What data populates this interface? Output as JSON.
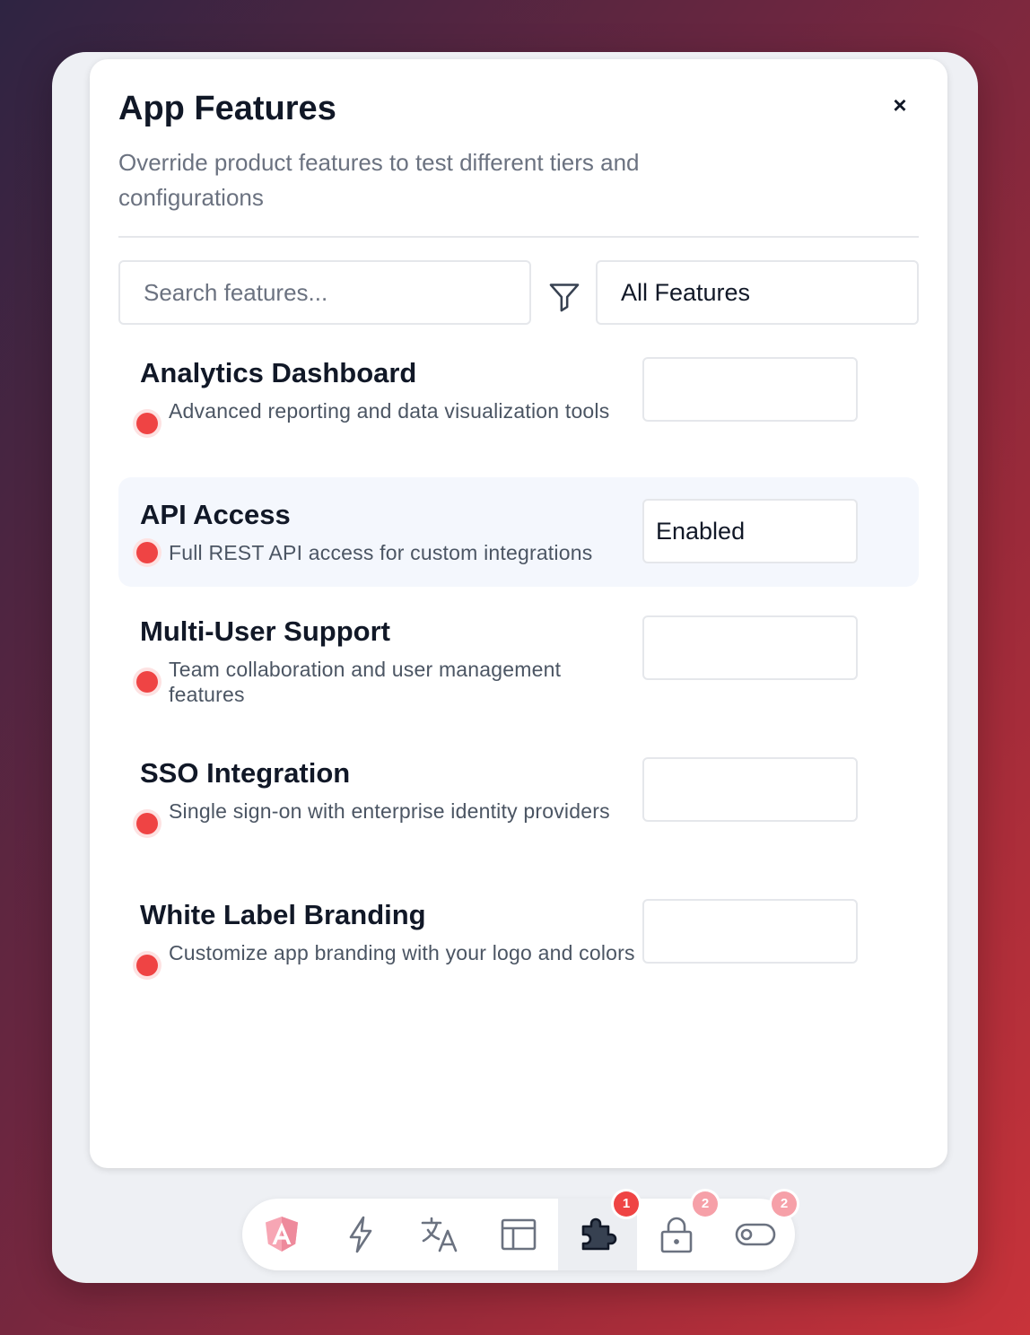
{
  "panel": {
    "title": "App Features",
    "close_glyph": "×",
    "subtitle": "Override product features to test different tiers and configurations",
    "search_placeholder": "Search features...",
    "filter_value": "All Features"
  },
  "features": [
    {
      "name": "Analytics Dashboard",
      "description": "Advanced reporting and data visualization tools",
      "value": ""
    },
    {
      "name": "API Access",
      "description": "Full REST API access for custom integrations",
      "value": "Enabled"
    },
    {
      "name": "Multi-User Support",
      "description": "Team collaboration and user management features",
      "value": ""
    },
    {
      "name": "SSO Integration",
      "description": "Single sign-on with enterprise identity providers",
      "value": ""
    },
    {
      "name": "White Label Branding",
      "description": "Customize app branding with your logo and colors",
      "value": ""
    }
  ],
  "dock": {
    "items": [
      {
        "icon": "angular-logo-icon"
      },
      {
        "icon": "lightning-icon"
      },
      {
        "icon": "translate-icon"
      },
      {
        "icon": "layout-icon"
      },
      {
        "icon": "puzzle-icon",
        "badge": "1"
      },
      {
        "icon": "lock-icon",
        "badge": "2"
      },
      {
        "icon": "toggle-icon",
        "badge": "2"
      }
    ]
  },
  "colors": {
    "status_dot": "#ef4444",
    "highlight_row": "#f4f7fd",
    "badge_active": "#ef4444",
    "badge_inactive": "#f6a0a8"
  }
}
